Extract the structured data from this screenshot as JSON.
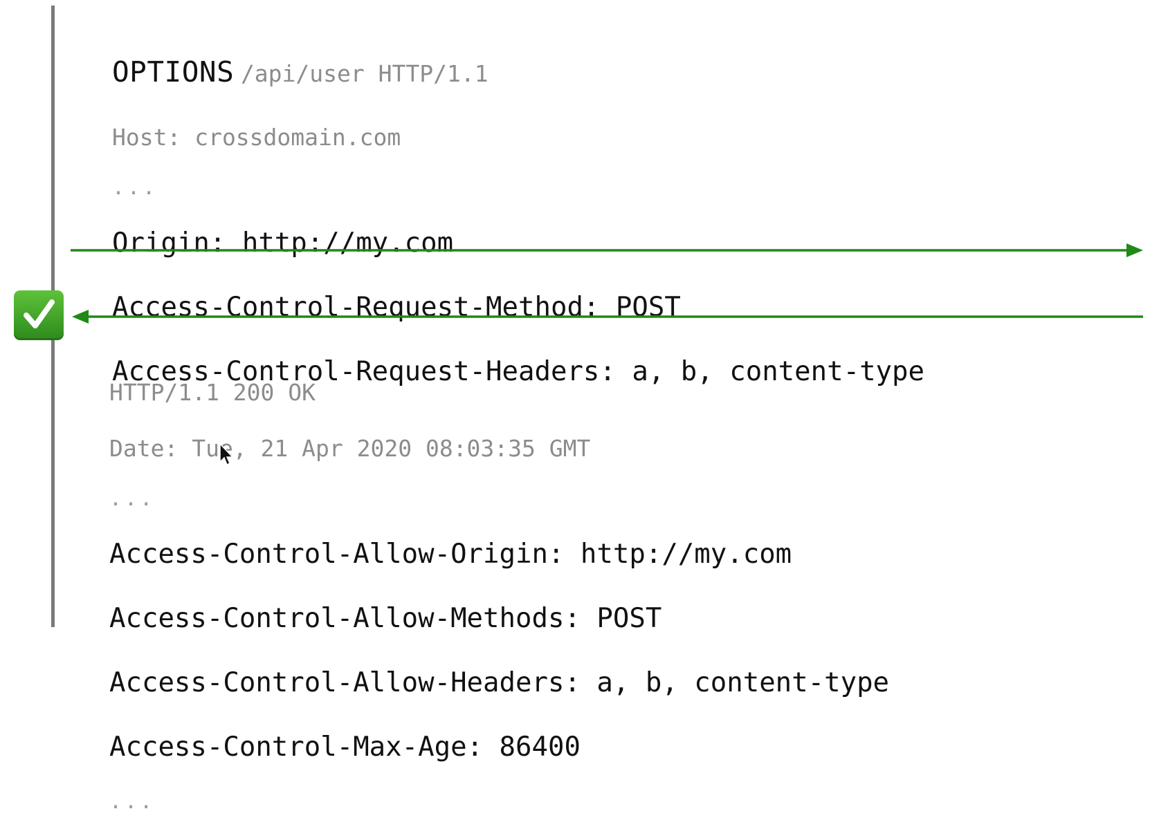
{
  "request": {
    "method": "OPTIONS",
    "path": "/api/user HTTP/1.1",
    "host_line": "Host: crossdomain.com",
    "ellipsis": "...",
    "headers": [
      "Origin: http://my.com",
      "Access-Control-Request-Method: POST",
      "Access-Control-Request-Headers: a, b, content-type"
    ]
  },
  "response": {
    "status_line": "HTTP/1.1 200 OK",
    "date_line": "Date: Tue, 21 Apr 2020 08:03:35 GMT",
    "ellipsis": "...",
    "headers": [
      "Access-Control-Allow-Origin: http://my.com",
      "Access-Control-Allow-Methods: POST",
      "Access-Control-Allow-Headers: a, b, content-type",
      "Access-Control-Max-Age: 86400"
    ],
    "trailing_ellipsis": "..."
  },
  "colors": {
    "arrow": "#1f8a16",
    "check_box": "#3fa82a",
    "timeline": "#7a7a7a"
  },
  "icons": {
    "check": "check-mark-icon",
    "cursor": "mouse-pointer-icon"
  }
}
